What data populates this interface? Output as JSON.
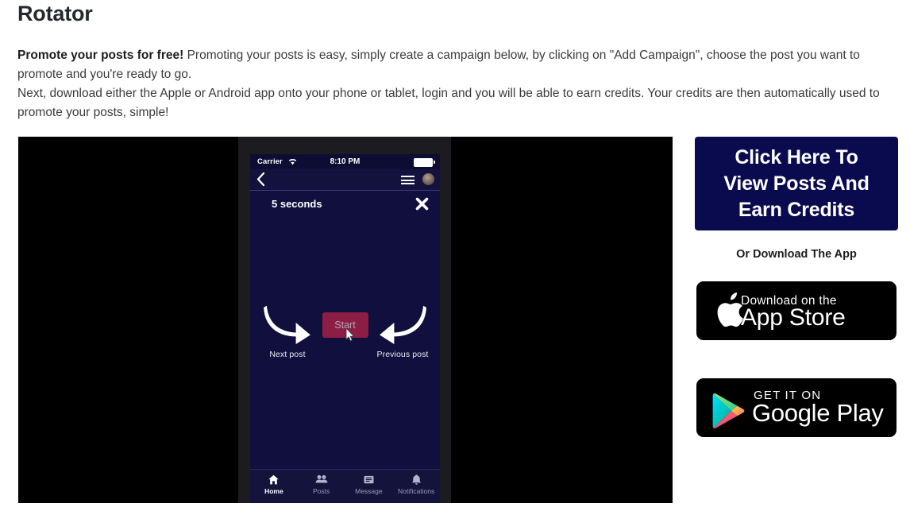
{
  "page": {
    "title": "Rotator",
    "intro_lead": "Promote your posts for free!",
    "intro_rest": " Promoting your posts is easy, simply create a campaign below, by clicking on \"Add Campaign\", choose the post you want to promote and you're ready to go.",
    "intro_line2": "Next, download either the Apple or Android app onto your phone or tablet, login and you will be able to earn credits. Your credits are then automatically used to promote your posts, simple!"
  },
  "phone": {
    "status": {
      "carrier": "Carrier",
      "time": "8:10 PM"
    },
    "timer_label": "5 seconds",
    "start_button": "Start",
    "next_post": "Next post",
    "previous_post": "Previous post",
    "tabs": [
      {
        "label": "Home",
        "icon": "home-icon",
        "active": true
      },
      {
        "label": "Posts",
        "icon": "people-icon",
        "active": false
      },
      {
        "label": "Message",
        "icon": "message-icon",
        "active": false
      },
      {
        "label": "Notifications",
        "icon": "bell-icon",
        "active": false
      }
    ]
  },
  "side": {
    "cta_line1": "Click Here To",
    "cta_line2": "View Posts And",
    "cta_line3": "Earn Credits",
    "or_download": "Or Download The App",
    "apple_top": "Download on the",
    "apple_bottom": "App Store",
    "play_top": "GET IT ON",
    "play_bottom": "Google Play"
  },
  "colors": {
    "cta_background": "#0a0a4f",
    "phone_screen": "#100f3e",
    "start_button": "#8c1e46",
    "badge_background": "#000000"
  }
}
